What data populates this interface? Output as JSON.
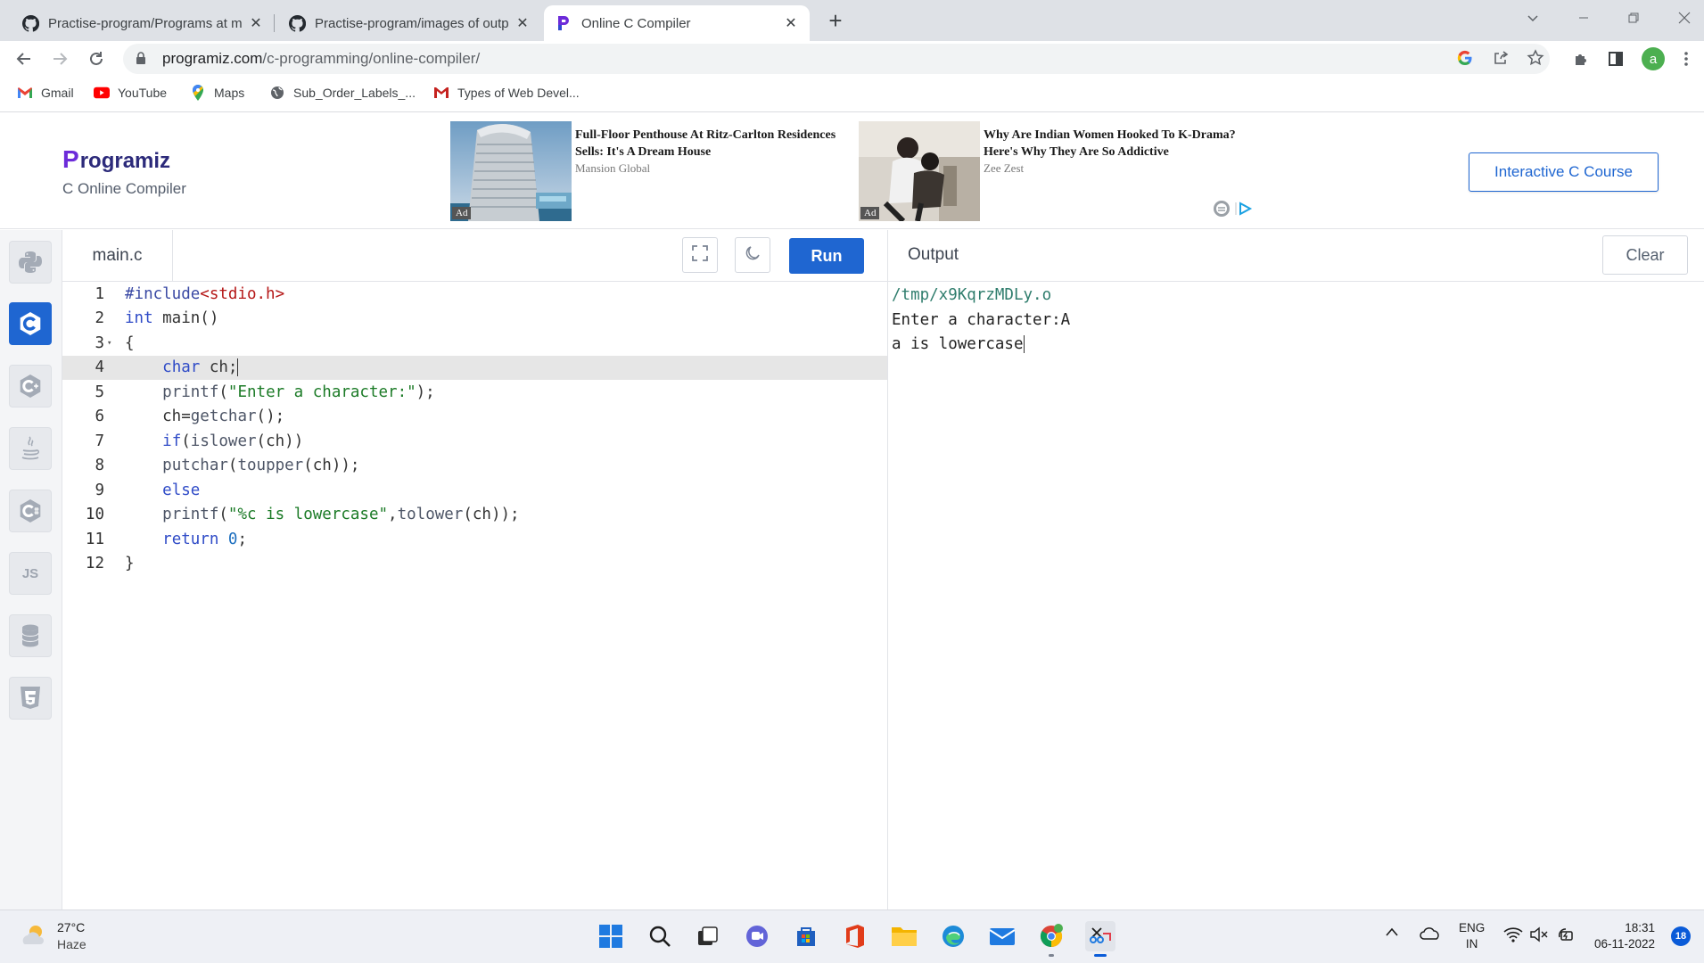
{
  "browser": {
    "tabs": [
      {
        "title": "Practise-program/Programs at m",
        "icon": "github-icon"
      },
      {
        "title": "Practise-program/images of outp",
        "icon": "github-icon"
      },
      {
        "title": "Online C Compiler",
        "icon": "programiz-icon"
      }
    ],
    "url_host": "programiz.com",
    "url_path": "/c-programming/online-compiler/",
    "profile_initial": "a",
    "bookmarks": [
      {
        "label": "Gmail",
        "icon": "gmail-icon"
      },
      {
        "label": "YouTube",
        "icon": "youtube-icon"
      },
      {
        "label": "Maps",
        "icon": "maps-icon"
      },
      {
        "label": "Sub_Order_Labels_...",
        "icon": "globe-icon"
      },
      {
        "label": "Types of Web Devel...",
        "icon": "gmail-icon"
      }
    ]
  },
  "header": {
    "logo_text": "rogramiz",
    "logo_p": "P",
    "subtitle": "C Online Compiler",
    "ads": [
      {
        "headline": "Full-Floor Penthouse At Ritz-Carlton Residences Sells: It's A Dream House",
        "source": "Mansion Global",
        "tag": "Ad"
      },
      {
        "headline": "Why Are Indian Women Hooked To K-Drama? Here's Why They Are So Addictive",
        "source": "Zee Zest",
        "tag": "Ad"
      }
    ],
    "course_button": "Interactive C Course"
  },
  "languages": [
    "python",
    "c",
    "cpp",
    "java",
    "csharp",
    "javascript",
    "sql",
    "html"
  ],
  "languages_js_label": "JS",
  "editor": {
    "filename": "main.c",
    "run_label": "Run",
    "highlighted_line": 4,
    "lines": [
      {
        "n": "1",
        "text": "#include<stdio.h>"
      },
      {
        "n": "2",
        "text": "int main()"
      },
      {
        "n": "3",
        "text": "{"
      },
      {
        "n": "4",
        "text": "    char ch;"
      },
      {
        "n": "5",
        "text": "    printf(\"Enter a character:\");"
      },
      {
        "n": "6",
        "text": "    ch=getchar();"
      },
      {
        "n": "7",
        "text": "    if(islower(ch))"
      },
      {
        "n": "8",
        "text": "    putchar(toupper(ch));"
      },
      {
        "n": "9",
        "text": "    else"
      },
      {
        "n": "10",
        "text": "    printf(\"%c is lowercase\",tolower(ch));"
      },
      {
        "n": "11",
        "text": "    return 0;"
      },
      {
        "n": "12",
        "text": "}"
      }
    ]
  },
  "output": {
    "title": "Output",
    "clear_label": "Clear",
    "lines": [
      "/tmp/x9KqrzMDLy.o",
      "Enter a character:A",
      "a is lowercase"
    ]
  },
  "taskbar": {
    "temperature": "27°C",
    "condition": "Haze",
    "lang_line1": "ENG",
    "lang_line2": "IN",
    "time": "18:31",
    "date": "06-11-2022",
    "notifications": "18"
  }
}
